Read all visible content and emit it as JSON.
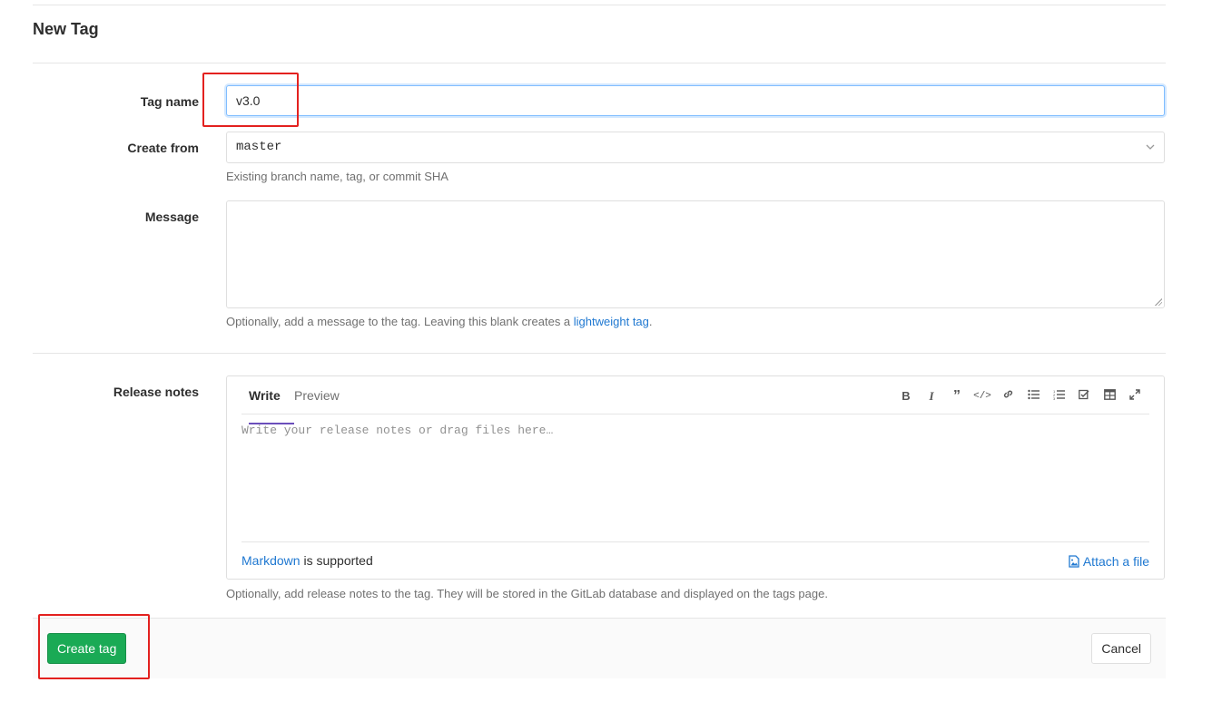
{
  "page": {
    "title": "New Tag"
  },
  "form": {
    "tag_name": {
      "label": "Tag name",
      "value": "v3.0"
    },
    "create_from": {
      "label": "Create from",
      "value": "master",
      "help": "Existing branch name, tag, or commit SHA"
    },
    "message": {
      "label": "Message",
      "help_prefix": "Optionally, add a message to the tag. Leaving this blank creates a ",
      "help_link": "lightweight tag",
      "help_suffix": "."
    },
    "release_notes": {
      "label": "Release notes",
      "tabs": {
        "write": "Write",
        "preview": "Preview"
      },
      "placeholder": "Write your release notes or drag files here…",
      "markdown_link": "Markdown",
      "markdown_suffix": " is supported",
      "attach_label": "Attach a file",
      "help": "Optionally, add release notes to the tag. They will be stored in the GitLab database and displayed on the tags page."
    },
    "toolbar_icons": [
      "bold-icon",
      "italic-icon",
      "quote-icon",
      "code-icon",
      "link-icon",
      "bulleted-list-icon",
      "numbered-list-icon",
      "task-list-icon",
      "table-icon",
      "fullscreen-icon"
    ]
  },
  "actions": {
    "create": "Create tag",
    "cancel": "Cancel"
  },
  "colors": {
    "primary_button": "#1aaa55",
    "link": "#1f78d1",
    "annotation": "#e3211f",
    "active_tab": "#6b4fbb"
  }
}
